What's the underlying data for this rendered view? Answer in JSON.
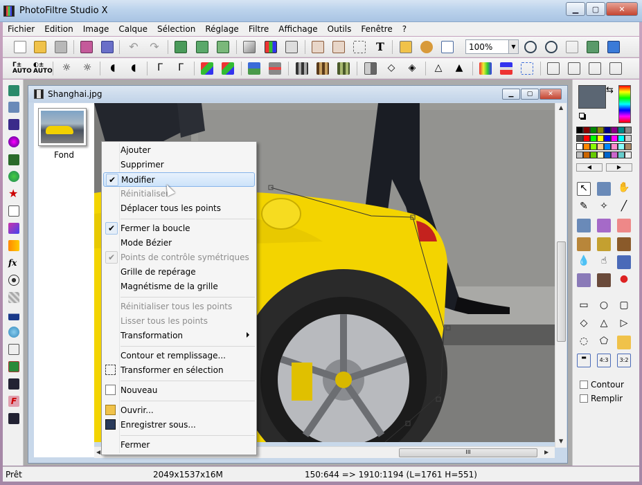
{
  "window": {
    "title": "PhotoFiltre Studio X",
    "min": "▁",
    "max": "▢",
    "close": "✕"
  },
  "menubar": [
    "Fichier",
    "Edition",
    "Image",
    "Calque",
    "Sélection",
    "Réglage",
    "Filtre",
    "Affichage",
    "Outils",
    "Fenêtre",
    "?"
  ],
  "toolbar": {
    "zoom_value": "100%"
  },
  "document": {
    "title": "Shanghai.jpg",
    "layer_label": "Fond",
    "hscroll_grip": "III"
  },
  "context_menu": {
    "items": [
      {
        "label": "Ajouter",
        "state": "enabled"
      },
      {
        "label": "Supprimer",
        "state": "enabled"
      },
      {
        "label": "Modifier",
        "state": "highlighted",
        "checked": true
      },
      {
        "label": "Réinitialiser",
        "state": "disabled"
      },
      {
        "label": "Déplacer tous les points",
        "state": "enabled"
      },
      {
        "label": "Fermer la boucle",
        "state": "enabled",
        "checked": true
      },
      {
        "label": "Mode Bézier",
        "state": "enabled"
      },
      {
        "label": "Points de contrôle symétriques",
        "state": "disabled",
        "checked": true
      },
      {
        "label": "Grille de repérage",
        "state": "enabled"
      },
      {
        "label": "Magnétisme de la grille",
        "state": "enabled"
      },
      {
        "label": "Réinitialiser tous les points",
        "state": "disabled"
      },
      {
        "label": "Lisser tous les points",
        "state": "disabled"
      },
      {
        "label": "Transformation",
        "state": "enabled",
        "submenu": true
      },
      {
        "label": "Contour et remplissage...",
        "state": "enabled"
      },
      {
        "label": "Transformer en sélection",
        "state": "enabled"
      },
      {
        "label": "Nouveau",
        "state": "enabled"
      },
      {
        "label": "Ouvrir...",
        "state": "enabled"
      },
      {
        "label": "Enregistrer sous...",
        "state": "enabled"
      },
      {
        "label": "Fermer",
        "state": "enabled"
      }
    ]
  },
  "right_panel": {
    "outline_label": "Contour",
    "fill_label": "Remplir"
  },
  "statusbar": {
    "status": "Prêt",
    "dimensions": "2049x1537x16M",
    "coords": "150:644 => 1910:1194 (L=1761  H=551)"
  },
  "colors": {
    "accent": "#86b4ea",
    "fg_swatch": "#5b6673",
    "bg_swatch": "#c8c8c8"
  }
}
